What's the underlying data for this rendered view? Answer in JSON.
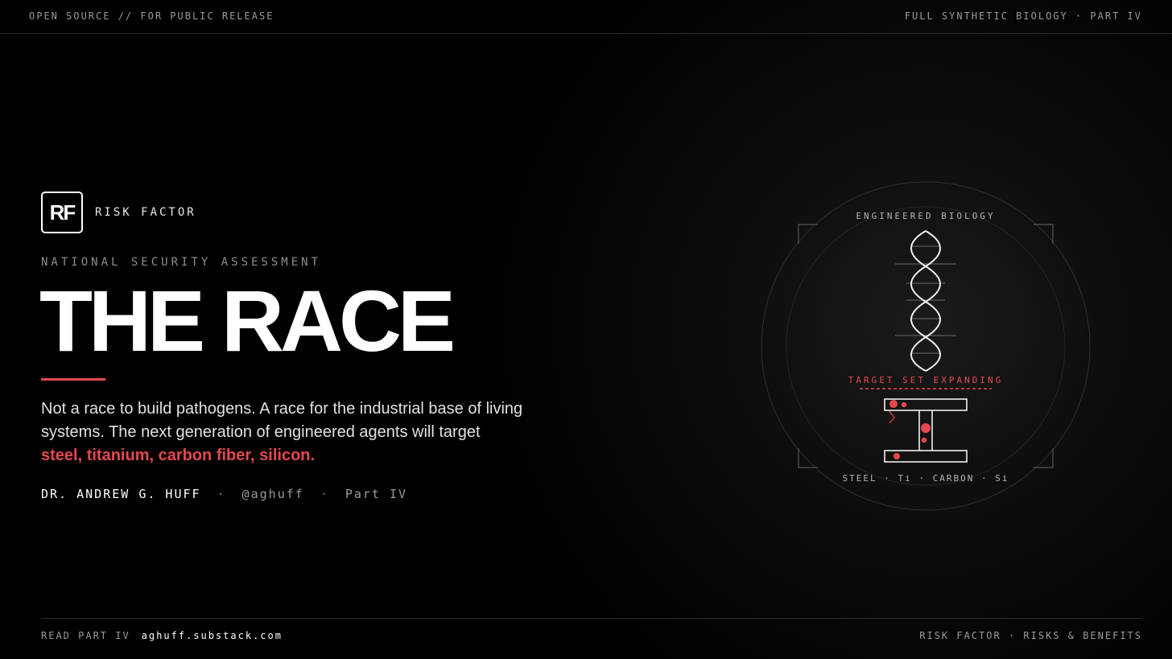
{
  "header": {
    "left": "OPEN SOURCE // FOR PUBLIC RELEASE",
    "right": "FULL SYNTHETIC BIOLOGY · PART IV"
  },
  "brand": {
    "logo_text": "RF",
    "name": "RISK FACTOR"
  },
  "hero": {
    "kicker": "NATIONAL SECURITY ASSESSMENT",
    "title": "THE RACE",
    "lede_text": "Not a race to build pathogens. A race for the industrial base of living systems. The next generation of engineered agents will target",
    "lede_highlight": "steel, titanium, carbon fiber, silicon."
  },
  "byline": {
    "author": "DR. ANDREW G. HUFF",
    "separator": "·",
    "handle": "@aghuff",
    "part": "Part IV"
  },
  "graphic": {
    "top_label": "ENGINEERED BIOLOGY",
    "mid_label": "TARGET SET EXPANDING",
    "bottom_label": "STEEL · Ti · CARBON · Si",
    "icons": [
      "dna-helix-icon",
      "i-beam-icon"
    ]
  },
  "footer": {
    "cta_label": "READ PART IV",
    "cta_link": "aghuff.substack.com",
    "right": "RISK FACTOR · RISKS & BENEFITS"
  },
  "colors": {
    "background": "#000000",
    "accent": "#e5484d",
    "text": "#ffffff",
    "muted": "#9a9a9a"
  }
}
